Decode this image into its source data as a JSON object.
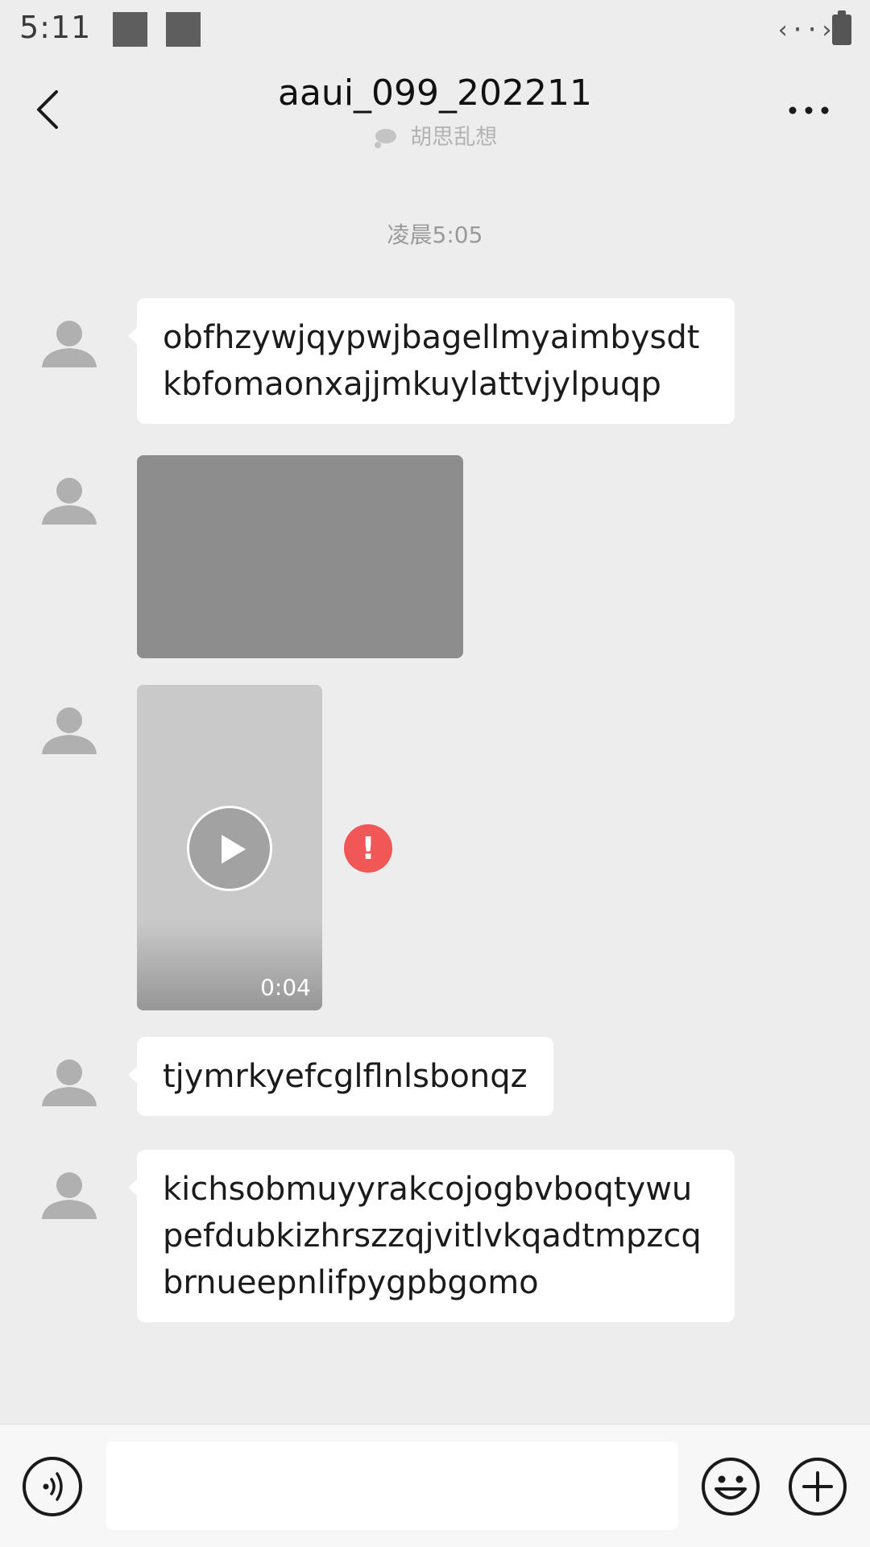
{
  "status_bar": {
    "time": "5:11",
    "data_icon": "‹··›"
  },
  "header": {
    "title": "aaui_099_202211",
    "subtitle": "胡思乱想",
    "back_icon": "chevron-left-icon",
    "more_icon": "more-dots-icon"
  },
  "chat": {
    "timestamp": "凌晨5:05",
    "messages": [
      {
        "type": "text",
        "text": "obfhzywjqypwjbagellmyaimbysdtkbfomaonxajjmkuylattvjylpuqp"
      },
      {
        "type": "image"
      },
      {
        "type": "video",
        "duration": "0:04",
        "send_failed": true,
        "error_glyph": "!"
      },
      {
        "type": "text",
        "text": "tjymrkyefcglflnlsbonqz"
      },
      {
        "type": "text",
        "text": "kichsobmuyyrakcojogbvboqtywupefdubkizhrszzqjvitlvkqadtmpzcqbrnueepnlifpygpbgomo"
      }
    ]
  },
  "input_bar": {
    "placeholder": "",
    "voice_icon": "voice-icon",
    "emoji_icon": "emoji-icon",
    "plus_icon": "plus-icon"
  },
  "colors": {
    "background": "#ededed",
    "bubble": "#ffffff",
    "error": "#f25757"
  }
}
